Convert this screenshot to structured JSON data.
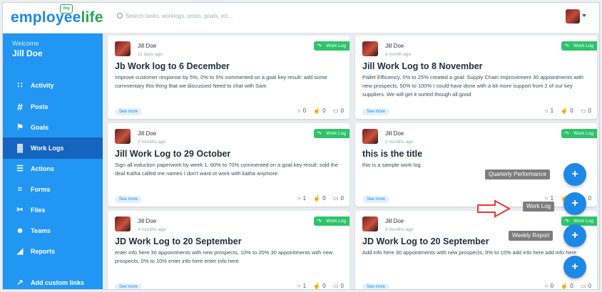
{
  "brand": {
    "logo_main": "employee",
    "logo_accent": "life",
    "logo_badge": "my"
  },
  "search": {
    "placeholder": "Search tasks, worklogs, posts, goals, etc..."
  },
  "sidebar": {
    "welcome": "Welcome",
    "username": "Jill Doe",
    "items": [
      {
        "label": "Activity",
        "icon": "rss-icon"
      },
      {
        "label": "Posts",
        "icon": "hash-icon"
      },
      {
        "label": "Goals",
        "icon": "flag-icon"
      },
      {
        "label": "Work Logs",
        "icon": "bar-chart-icon",
        "active": true
      },
      {
        "label": "Actions",
        "icon": "list-check-icon"
      },
      {
        "label": "Forms",
        "icon": "list-icon"
      },
      {
        "label": "Files",
        "icon": "paperclip-icon"
      },
      {
        "label": "Teams",
        "icon": "users-icon"
      },
      {
        "label": "Reports",
        "icon": "area-chart-icon"
      },
      {
        "label": "Add custom links",
        "icon": "external-link-icon"
      }
    ]
  },
  "cards": [
    {
      "author": "Jill Doe",
      "time": "11 days ago",
      "tag": "Work Log",
      "title": "Jb Work log to 6 December",
      "body": "Improve customer response by 5%, 0% to 5% commented on a goal key result: add some commentary this thing that we discussed Need to chat with Sam",
      "see_more": "See more",
      "views": "0",
      "likes": "0",
      "comments": "0"
    },
    {
      "author": "Jill Doe",
      "time": "a month ago",
      "tag": "Work Log",
      "title": "Jill Work Log to 8 November",
      "body": "Pallet Efficiency, 0% to 25% created a goal: Supply Chain Improvement 30 appointments with new prospects, 50% to 100% I could have done with a bit more support from 2 of our key suppliers. We will get it sorted though all good",
      "see_more": "See more",
      "views": "1",
      "likes": "0",
      "comments": "0"
    },
    {
      "author": "Jill Doe",
      "time": "2 months ago",
      "tag": "Work Log",
      "title": "Jill Work Log to 29 October",
      "body": "Sign all induction paperwork by week 1, 60% to 70% commented on a goal key result: sold the deal Katha called me names I don't want ot work with katha anymore.",
      "see_more": "See more",
      "views": "1",
      "likes": "0",
      "comments": "0"
    },
    {
      "author": "Jill Doe",
      "time": "2 months ago",
      "tag": "Work Log",
      "title": "this is the title",
      "body": "this is a sample work log",
      "see_more": "See more",
      "views": "1",
      "likes": "0",
      "comments": "0"
    },
    {
      "author": "Jill Doe",
      "time": "3 months ago",
      "tag": "Work Log",
      "title": "JD Work Log to 20 September",
      "body": "enter info here 30 appointments with new prospects, 10% to 20% 30 appointments with new prospects, 0% to 10% enter info here enter info here",
      "see_more": "See more",
      "views": "1",
      "likes": "0",
      "comments": "0"
    },
    {
      "author": "Jill Doe",
      "time": "3 months ago",
      "tag": "Work Log",
      "title": "JD Work Log to 20 September",
      "body": "Add info here 30 appointments with new prospects, 0% to 10% add info here add info here",
      "see_more": "See more",
      "views": "0",
      "likes": "0",
      "comments": "0"
    }
  ],
  "fab_menu": {
    "quarterly": "Quarterly Performance",
    "worklog": "Work Log",
    "weekly": "Weekly Report",
    "plus": "+"
  },
  "colors": {
    "primary": "#2196f3",
    "active": "#1565c0",
    "tag": "#2ec36b",
    "fab": "#1e88e5"
  }
}
